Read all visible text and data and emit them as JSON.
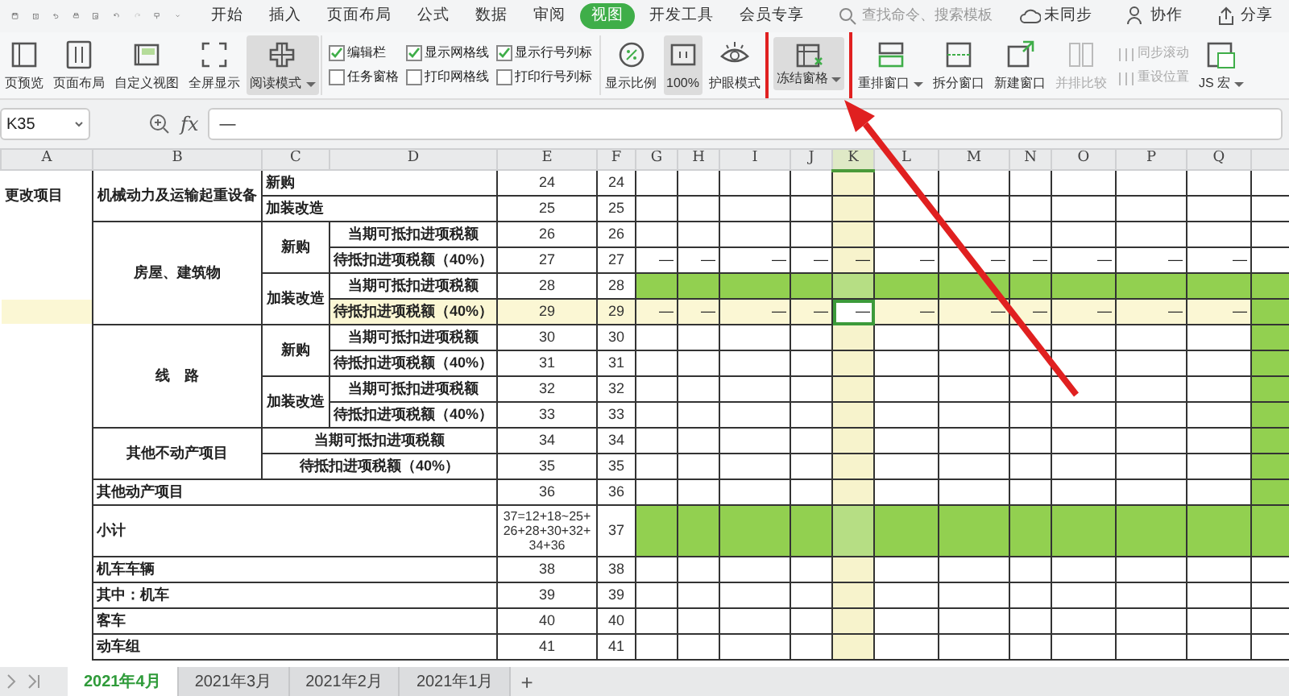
{
  "menu": {
    "tabs": [
      {
        "label": "开始",
        "selected": false
      },
      {
        "label": "插入",
        "selected": false
      },
      {
        "label": "页面布局",
        "selected": false
      },
      {
        "label": "公式",
        "selected": false
      },
      {
        "label": "数据",
        "selected": false
      },
      {
        "label": "审阅",
        "selected": false
      },
      {
        "label": "视图",
        "selected": true
      },
      {
        "label": "开发工具",
        "selected": false
      },
      {
        "label": "会员专享",
        "selected": false
      }
    ],
    "search": {
      "placeholder": "查找命令、搜索模板"
    },
    "actions": [
      "未同步",
      "协作",
      "分享"
    ]
  },
  "ribbon": [
    {
      "kind": "large",
      "label": "页预览",
      "pressed": false,
      "dropdown": false,
      "disabled": false,
      "annotated": false
    },
    {
      "kind": "large",
      "label": "页面布局",
      "pressed": false,
      "dropdown": false,
      "disabled": false,
      "annotated": false
    },
    {
      "kind": "large",
      "label": "自定义视图",
      "pressed": false,
      "dropdown": false,
      "disabled": false,
      "annotated": false
    },
    {
      "kind": "large",
      "label": "全屏显示",
      "pressed": false,
      "dropdown": false,
      "disabled": false,
      "annotated": false
    },
    {
      "kind": "large",
      "label": "阅读模式",
      "pressed": true,
      "dropdown": true,
      "disabled": false,
      "annotated": false
    },
    {
      "kind": "checks",
      "items": [
        {
          "label": "编辑栏",
          "checked": true
        },
        {
          "label": "显示网格线",
          "checked": true
        },
        {
          "label": "显示行号列标",
          "checked": true
        },
        {
          "label": "任务窗格",
          "checked": false
        },
        {
          "label": "打印网格线",
          "checked": false
        },
        {
          "label": "打印行号列标",
          "checked": false
        }
      ]
    },
    {
      "kind": "large",
      "label": "显示比例",
      "pressed": false,
      "dropdown": false,
      "disabled": false,
      "annotated": false
    },
    {
      "kind": "large",
      "label": "100%",
      "pressed": true,
      "dropdown": false,
      "disabled": false,
      "annotated": false
    },
    {
      "kind": "large",
      "label": "护眼模式",
      "pressed": false,
      "dropdown": false,
      "disabled": false,
      "annotated": false
    },
    {
      "kind": "large",
      "label": "冻结窗格",
      "pressed": true,
      "dropdown": true,
      "disabled": false,
      "annotated": true
    },
    {
      "kind": "large",
      "label": "重排窗口",
      "pressed": false,
      "dropdown": true,
      "disabled": false,
      "annotated": false
    },
    {
      "kind": "large",
      "label": "拆分窗口",
      "pressed": false,
      "dropdown": false,
      "disabled": false,
      "annotated": false
    },
    {
      "kind": "large",
      "label": "新建窗口",
      "pressed": false,
      "dropdown": false,
      "disabled": false,
      "annotated": false
    },
    {
      "kind": "large",
      "label": "并排比较",
      "pressed": false,
      "dropdown": false,
      "disabled": true,
      "annotated": false
    },
    {
      "kind": "smalls",
      "items": [
        {
          "label": "同步滚动",
          "disabled": true
        },
        {
          "label": "重设位置",
          "disabled": true
        }
      ]
    },
    {
      "kind": "large",
      "label": "JS 宏",
      "pressed": false,
      "dropdown": true,
      "disabled": false,
      "annotated": false
    }
  ],
  "formula_bar": {
    "cell": "K35",
    "fx": "fx",
    "formula": "—"
  },
  "sheet": {
    "columns": [
      {
        "label": "A",
        "selected": false
      },
      {
        "label": "B",
        "selected": false
      },
      {
        "label": "C",
        "selected": false
      },
      {
        "label": "D",
        "selected": false
      },
      {
        "label": "E",
        "selected": false
      },
      {
        "label": "F",
        "selected": false
      },
      {
        "label": "G",
        "selected": false
      },
      {
        "label": "H",
        "selected": false
      },
      {
        "label": "I",
        "selected": false
      },
      {
        "label": "J",
        "selected": false
      },
      {
        "label": "K",
        "selected": true
      },
      {
        "label": "L",
        "selected": false
      },
      {
        "label": "M",
        "selected": false
      },
      {
        "label": "N",
        "selected": false
      },
      {
        "label": "O",
        "selected": false
      },
      {
        "label": "P",
        "selected": false
      },
      {
        "label": "Q",
        "selected": false
      }
    ],
    "rows": [
      {
        "labels": [
          "更改项目",
          "机械动力及运输起重设备",
          "新购"
        ],
        "e": "24",
        "f": "24",
        "kind": "blank",
        "highlighted": false,
        "edge_fill": false
      },
      {
        "labels": [
          "加装改造"
        ],
        "e": "25",
        "f": "25",
        "kind": "blank",
        "highlighted": false,
        "edge_fill": false
      },
      {
        "labels": [
          "房屋、建筑物",
          "新购",
          "当期可抵扣进项税额"
        ],
        "e": "26",
        "f": "26",
        "kind": "blank",
        "highlighted": false,
        "edge_fill": false
      },
      {
        "labels": [
          "待抵扣进项税额（40%）"
        ],
        "e": "27",
        "f": "27",
        "kind": "dash",
        "marks": [
          "—",
          "—",
          "—",
          "—",
          "—",
          "—",
          "—",
          "—",
          "—",
          "—",
          "—"
        ],
        "highlighted": false,
        "edge_fill": false
      },
      {
        "labels": [
          "加装改造",
          "当期可抵扣进项税额"
        ],
        "e": "28",
        "f": "28",
        "kind": "fill",
        "highlighted": false,
        "edge_fill": true
      },
      {
        "labels": [
          "待抵扣进项税额（40%）"
        ],
        "e": "29",
        "f": "29",
        "kind": "dash",
        "marks": [
          "—",
          "—",
          "—",
          "—",
          "—",
          "—",
          "—",
          "—",
          "—",
          "—",
          "—"
        ],
        "highlighted": true,
        "edge_fill": true
      },
      {
        "labels": [
          "线　路",
          "新购",
          "当期可抵扣进项税额"
        ],
        "e": "30",
        "f": "30",
        "kind": "blank",
        "highlighted": false,
        "edge_fill": true
      },
      {
        "labels": [
          "待抵扣进项税额（40%）"
        ],
        "e": "31",
        "f": "31",
        "kind": "blank",
        "highlighted": false,
        "edge_fill": true
      },
      {
        "labels": [
          "加装改造",
          "当期可抵扣进项税额"
        ],
        "e": "32",
        "f": "32",
        "kind": "blank",
        "highlighted": false,
        "edge_fill": true
      },
      {
        "labels": [
          "待抵扣进项税额（40%）"
        ],
        "e": "33",
        "f": "33",
        "kind": "blank",
        "highlighted": false,
        "edge_fill": true
      },
      {
        "labels": [
          "其他不动产项目",
          "当期可抵扣进项税额"
        ],
        "e": "34",
        "f": "34",
        "kind": "blank",
        "highlighted": false,
        "edge_fill": true
      },
      {
        "labels": [
          "待抵扣进项税额（40%）"
        ],
        "e": "35",
        "f": "35",
        "kind": "blank",
        "highlighted": false,
        "edge_fill": true
      },
      {
        "labels": [
          "其他动产项目"
        ],
        "e": "36",
        "f": "36",
        "kind": "blank",
        "highlighted": false,
        "edge_fill": true
      },
      {
        "labels": [
          "小计"
        ],
        "e": "37=12+18~25+26+28+30+32+34+36",
        "f": "37",
        "kind": "fill",
        "highlighted": false,
        "edge_fill": false
      },
      {
        "labels": [
          "机车车辆"
        ],
        "e": "38",
        "f": "38",
        "kind": "blank",
        "highlighted": false,
        "edge_fill": false
      },
      {
        "labels": [
          "其中：机车"
        ],
        "e": "39",
        "f": "39",
        "kind": "blank",
        "highlighted": false,
        "edge_fill": false
      },
      {
        "labels": [
          "客车"
        ],
        "e": "40",
        "f": "40",
        "kind": "blank",
        "highlighted": false,
        "edge_fill": false
      },
      {
        "labels": [
          "动车组"
        ],
        "e": "41",
        "f": "41",
        "kind": "blank",
        "highlighted": false,
        "edge_fill": false
      }
    ]
  },
  "sheet_tabs": [
    {
      "label": "2021年4月",
      "selected": true
    },
    {
      "label": "2021年3月",
      "selected": false
    },
    {
      "label": "2021年2月",
      "selected": false
    },
    {
      "label": "2021年1月",
      "selected": false
    }
  ],
  "add_sheet": "+"
}
